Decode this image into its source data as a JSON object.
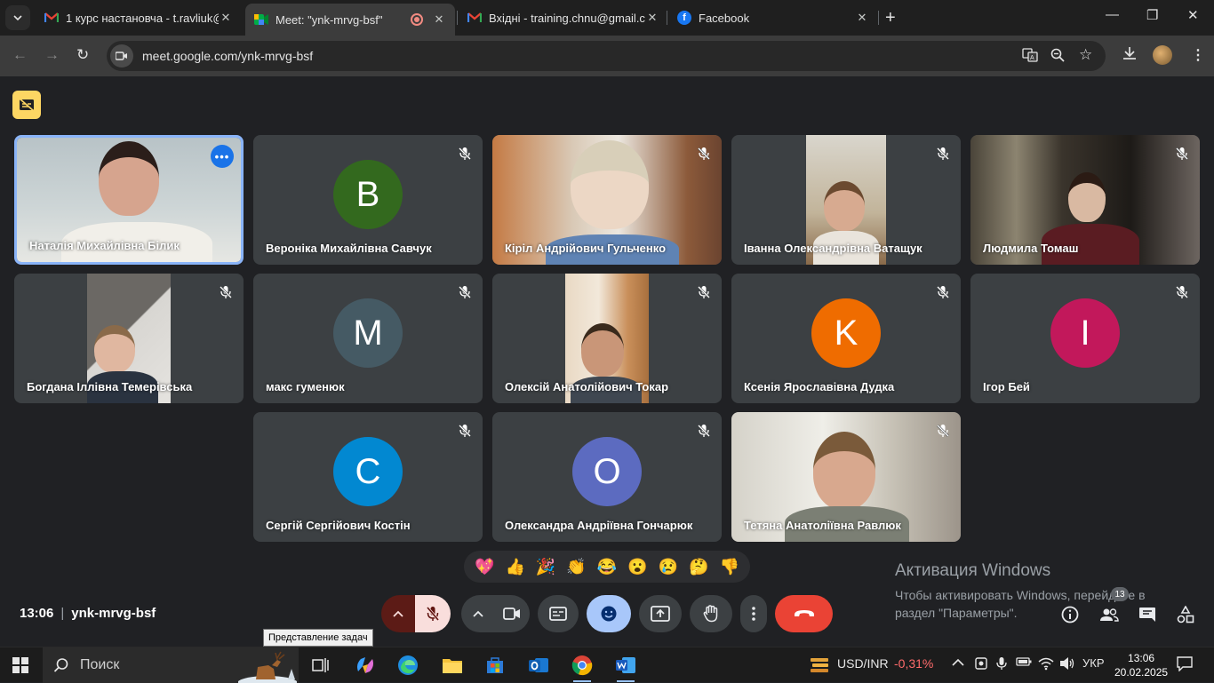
{
  "browser": {
    "tabs": [
      {
        "title": "1 курс настановча - t.ravliuk@",
        "favicon": "gmail-icon"
      },
      {
        "title": "Meet: \"ynk-mrvg-bsf\"",
        "favicon": "meet-icon",
        "active": true
      },
      {
        "title": "Вхідні - training.chnu@gmail.co",
        "favicon": "gmail-icon"
      },
      {
        "title": "Facebook",
        "favicon": "facebook-icon"
      }
    ],
    "url": "meet.google.com/ynk-mrvg-bsf"
  },
  "meet": {
    "participants": [
      {
        "name": "Наталія Михайлівна Білик",
        "type": "video",
        "speaking": true
      },
      {
        "name": "Вероніка Михайлівна Савчук",
        "type": "avatar",
        "initial": "B",
        "color": "#33691e"
      },
      {
        "name": "Кіріл Андрійович Гульченко",
        "type": "video"
      },
      {
        "name": "Іванна Олександрівна Ватащук",
        "type": "video"
      },
      {
        "name": "Людмила Томаш",
        "type": "video"
      },
      {
        "name": "Богдана Іллівна Темерівська",
        "type": "video"
      },
      {
        "name": "макс гуменюк",
        "type": "avatar",
        "initial": "M",
        "color": "#455a64"
      },
      {
        "name": "Олексій Анатолійович Токар",
        "type": "video"
      },
      {
        "name": "Ксенія Ярославівна Дудка",
        "type": "avatar",
        "initial": "K",
        "color": "#ef6c00"
      },
      {
        "name": "Ігор Бей",
        "type": "avatar",
        "initial": "I",
        "color": "#c2185b"
      },
      {
        "name": "Сергій Сергійович Костін",
        "type": "avatar",
        "initial": "C",
        "color": "#0288d1"
      },
      {
        "name": "Олександра Андріївна Гончарюк",
        "type": "avatar",
        "initial": "O",
        "color": "#5c6bc0"
      },
      {
        "name": "Тетяна Анатоліївна Равлюк",
        "type": "video"
      }
    ],
    "reactions": [
      "💖",
      "👍",
      "🎉",
      "👏",
      "😂",
      "😮",
      "😢",
      "🤔",
      "👎"
    ],
    "time": "13:06",
    "meeting_code": "ynk-mrvg-bsf",
    "people_count": "13",
    "tooltip": "Представление задач"
  },
  "windows_activation": {
    "title": "Активация Windows",
    "line1": "Чтобы активировать Windows, перейдите в",
    "line2": "раздел \"Параметры\"."
  },
  "taskbar": {
    "search_label": "Поиск",
    "currency_label": "USD/INR",
    "currency_change": "-0,31%",
    "language": "УКР",
    "time": "13:06",
    "date": "20.02.2025"
  },
  "colors": {
    "speaking_border": "#8ab4f8",
    "hangup": "#ea4335",
    "mic_off": "#f9dedc",
    "reaction_active": "#a8c7fa"
  }
}
